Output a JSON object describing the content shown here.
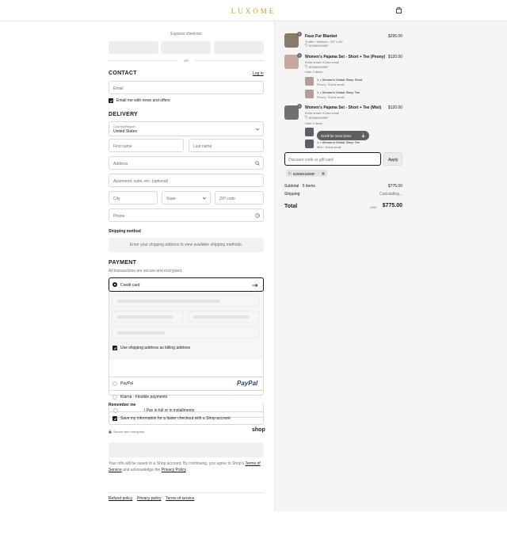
{
  "header": {
    "logo": "LUXOME",
    "bag_icon": "bag-icon"
  },
  "express": {
    "title": "Express checkout",
    "divider": "OR"
  },
  "contact": {
    "title": "CONTACT",
    "login_link": "Log in",
    "email_placeholder": "Email",
    "news_label": "Email me with news and offers",
    "news_checked": true
  },
  "delivery": {
    "title": "DELIVERY",
    "country_label": "Country/Region",
    "country_value": "United States",
    "first_name": "First name",
    "last_name": "Last name",
    "address": "Address",
    "apartment": "Apartment, suite, etc. (optional)",
    "city": "City",
    "state": "State",
    "zip": "ZIP code",
    "phone": "Phone"
  },
  "shipping": {
    "title": "Shipping method",
    "notice": "Enter your shipping address to view available shipping methods."
  },
  "payment": {
    "title": "PAYMENT",
    "subtitle": "All transactions are secure and encrypted.",
    "credit_card": "Credit card",
    "billing_label": "Use shipping address as billing address",
    "paypal": "PayPal",
    "paypal_logo": "PayPal",
    "klarna": "Klarna - Flexible payments",
    "installments": "| Pay in full or in installments"
  },
  "remember": {
    "title": "Remember me",
    "save_label": "Save my information for a faster checkout with a Shop account",
    "secure": "Secure and encrypted",
    "shop_logo": "shop"
  },
  "legal": {
    "text_1": "Your info will be saved to a Shop account. By continuing, you agree to Shop's",
    "terms": "Terms of Service",
    "text_2": "and acknowledge the",
    "privacy": "Privacy Policy",
    "end": "."
  },
  "footer": {
    "links": [
      "Refund policy",
      "Privacy policy",
      "Terms of service"
    ]
  },
  "order": {
    "items": [
      {
        "name": "Faux Fur Blanket",
        "variant": "Truffle / Medium - 50\" x 60\"",
        "code": "8296815659F",
        "price": "$295.00",
        "qty": "1"
      },
      {
        "name": "Women's Pajama Set - Short + Tee (Peony)",
        "variant": "Extra small / Extra small",
        "code": "8296815659F",
        "price": "$120.00",
        "qty": "1",
        "hide_label": "Hide 2 items",
        "sub": [
          {
            "name": "1 × Women's Modal Sleep Short",
            "variant": "Peony / Extra small"
          },
          {
            "name": "1 × Women's Modal Sleep Tee",
            "variant": "Peony / Extra small"
          }
        ]
      },
      {
        "name": "Women's Pajama Set - Short + Tee (Mist)",
        "variant": "Extra small / Extra small",
        "code": "8296815659F",
        "price": "$120.00",
        "qty": "1",
        "hide_label": "Hide 2 items",
        "sub": [
          {
            "name": "1 × Women's Modal Sleep Short",
            "variant": "Mist / Extra small"
          },
          {
            "name": "1 × Women's Modal Sleep Tee",
            "variant": "Mist / Extra small"
          }
        ]
      }
    ],
    "scroll_hint": "Scroll for more items",
    "discount_placeholder": "Discount code or gift card",
    "apply": "Apply",
    "applied_code": "8296815659F",
    "subtotal_label": "Subtotal · 5 items",
    "subtotal": "$775.00",
    "shipping_label": "Shipping",
    "shipping_value": "Calculating...",
    "total_label": "Total",
    "currency": "USD",
    "total": "$775.00"
  }
}
